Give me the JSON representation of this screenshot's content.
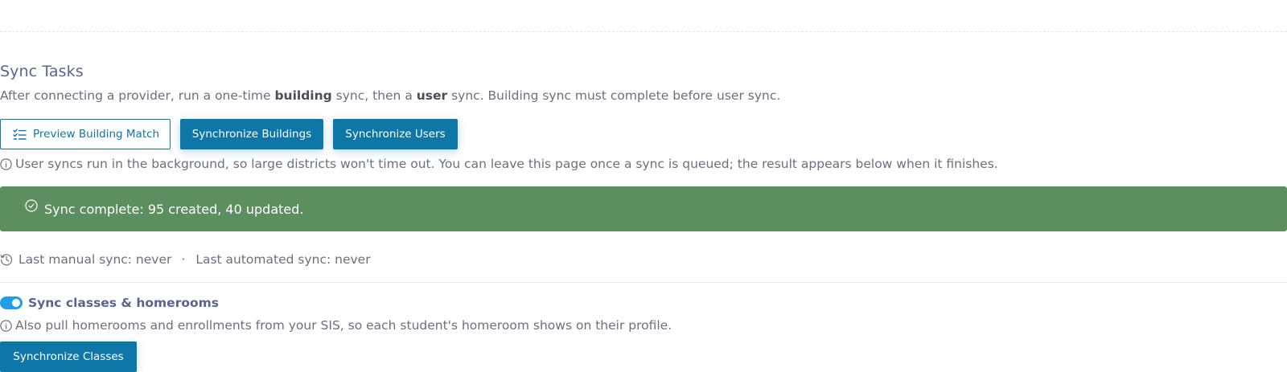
{
  "section": {
    "title": "Sync Tasks",
    "intro": {
      "part1": "After connecting a provider, run a one-time ",
      "bold1": "building",
      "part2": " sync, then a ",
      "bold2": "user",
      "part3": " sync. Building sync must complete before user sync."
    }
  },
  "buttons": {
    "preview": "Preview Building Match",
    "sync_buildings": "Synchronize Buildings",
    "sync_users": "Synchronize Users",
    "sync_classes": "Synchronize Classes"
  },
  "info": {
    "background_note": "User syncs run in the background, so large districts won't time out. You can leave this page once a sync is queued; the result appears below when it finishes.",
    "classes_note": "Also pull homerooms and enrollments from your SIS, so each student's homeroom shows on their profile."
  },
  "alert": {
    "message": "Sync complete: 95 created, 40 updated.",
    "color": "#5b8f5f"
  },
  "last_sync": {
    "manual": "Last manual sync: never",
    "separator": "·",
    "automated": "Last automated sync: never"
  },
  "classes_toggle": {
    "label": "Sync classes & homerooms",
    "enabled": true,
    "color": "#1e9fe8"
  },
  "colors": {
    "primary": "#0f76a8",
    "heading": "#5a6494",
    "text": "#6b6f80"
  },
  "icons": {
    "preview": "checklist-icon",
    "info": "info-circle-icon",
    "alert": "check-circle-icon",
    "history": "history-icon"
  }
}
